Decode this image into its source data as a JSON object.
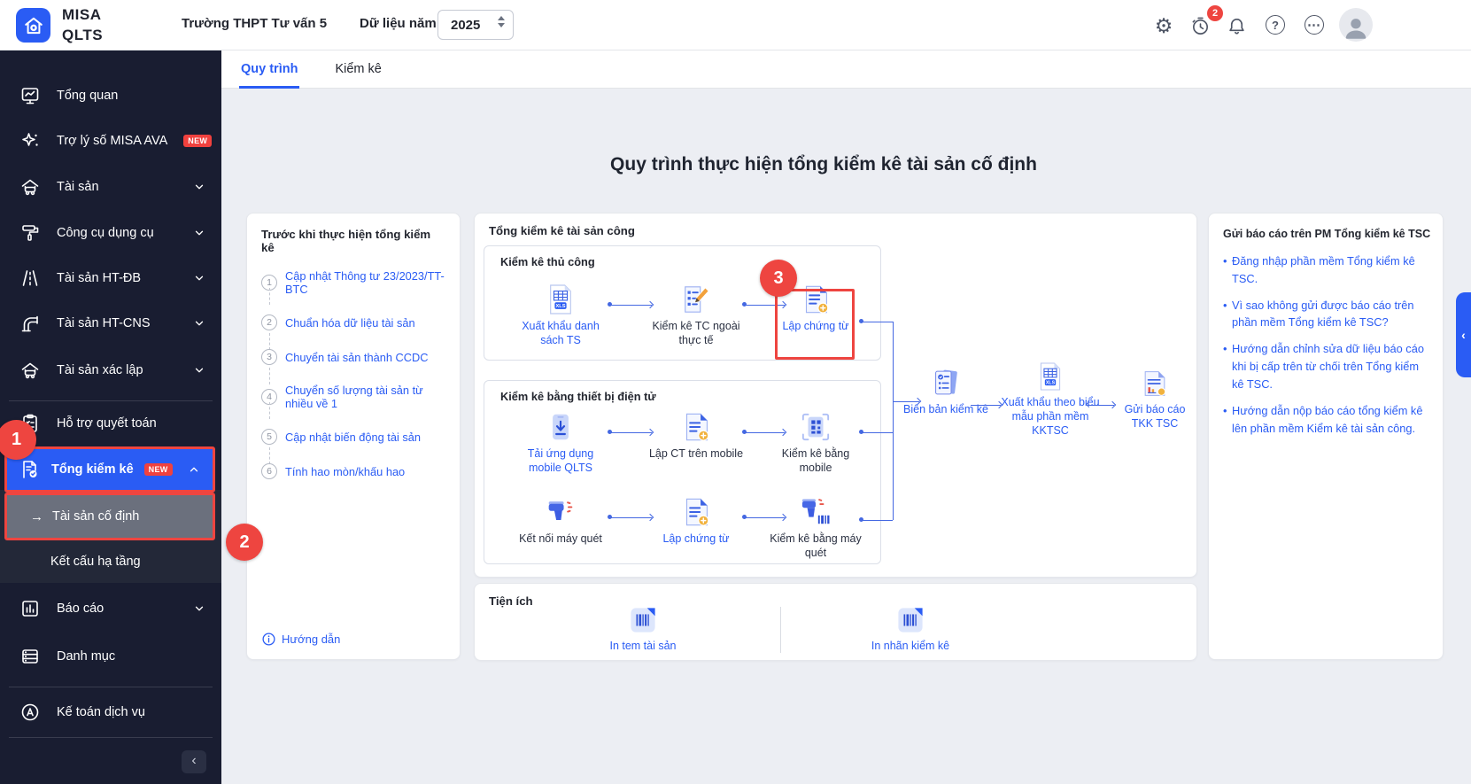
{
  "header": {
    "app_name_top": "MISA",
    "app_name_bottom": "QLTS",
    "org_name": "Trường THPT Tư vấn 5",
    "year_label": "Dữ liệu năm",
    "year_value": "2025",
    "notification_count": "2"
  },
  "sidebar": {
    "items": [
      {
        "label": "Tổng quan"
      },
      {
        "label": "Trợ lý số MISA AVA",
        "badge": "NEW"
      },
      {
        "label": "Tài sản"
      },
      {
        "label": "Công cụ dụng cụ"
      },
      {
        "label": "Tài sản HT-ĐB"
      },
      {
        "label": "Tài sản HT-CNS"
      },
      {
        "label": "Tài sản xác lập"
      },
      {
        "label": "Hỗ trợ quyết toán"
      },
      {
        "label": "Tổng kiểm kê",
        "badge": "NEW"
      },
      {
        "label": "Tài sản cố định"
      },
      {
        "label": "Kết cấu hạ tầng"
      },
      {
        "label": "Báo cáo"
      },
      {
        "label": "Danh mục"
      },
      {
        "label": "Kế toán dịch vụ"
      }
    ]
  },
  "tabs": [
    {
      "label": "Quy trình"
    },
    {
      "label": "Kiểm kê"
    }
  ],
  "page_title": "Quy trình thực hiện tổng kiểm kê tài sản cố định",
  "before_card": {
    "title": "Trước khi thực hiện tổng kiểm kê",
    "steps": [
      {
        "num": "1",
        "label": "Cập nhật Thông tư 23/2023/TT-BTC"
      },
      {
        "num": "2",
        "label": "Chuẩn hóa dữ liệu tài sản"
      },
      {
        "num": "3",
        "label": "Chuyển tài sản thành CCDC"
      },
      {
        "num": "4",
        "label": "Chuyển số lượng tài sản từ nhiều về 1"
      },
      {
        "num": "5",
        "label": "Cập nhật biến động tài sản"
      },
      {
        "num": "6",
        "label": "Tính hao mòn/khấu hao"
      }
    ],
    "guide_label": "Hướng dẫn"
  },
  "flow_card": {
    "title": "Tổng kiểm kê tài sản công",
    "manual_section": {
      "title": "Kiểm kê thủ công",
      "steps": [
        {
          "label": "Xuất khẩu danh sách TS"
        },
        {
          "label": "Kiểm kê TC ngoài thực tế"
        },
        {
          "label": "Lập chứng từ"
        }
      ]
    },
    "electronic_section": {
      "title": "Kiểm kê bằng thiết bị điện tử",
      "row1": [
        {
          "label": "Tải ứng dụng mobile QLTS"
        },
        {
          "label": "Lập CT trên mobile"
        },
        {
          "label": "Kiểm kê bằng mobile"
        }
      ],
      "row2": [
        {
          "label": "Kết nối máy quét"
        },
        {
          "label": "Lập chứng từ"
        },
        {
          "label": "Kiểm kê bằng máy quét"
        }
      ]
    },
    "outputs": [
      {
        "label": "Biên bản kiểm kê"
      },
      {
        "label": "Xuất khẩu theo biểu mẫu phần mềm KKTSC"
      },
      {
        "label": "Gửi báo cáo TKK TSC"
      }
    ]
  },
  "utilities_card": {
    "title": "Tiện ích",
    "items": [
      {
        "label": "In tem tài sản"
      },
      {
        "label": "In nhãn kiểm kê"
      }
    ]
  },
  "help_card": {
    "title": "Gửi báo cáo trên PM Tổng kiểm kê TSC",
    "links": [
      {
        "label": "Đăng nhập phần mềm Tổng kiểm kê TSC."
      },
      {
        "label": "Vì sao không gửi được báo cáo trên phần mềm Tổng kiểm kê TSC?"
      },
      {
        "label": "Hướng dẫn chỉnh sửa dữ liệu báo cáo khi bị cấp trên từ chối trên Tổng kiểm kê TSC."
      },
      {
        "label": "Hướng dẫn nộp báo cáo tổng kiểm kê lên phần mềm Kiểm kê tài sản công."
      }
    ]
  },
  "annotations": {
    "badge1": "1",
    "badge2": "2",
    "badge3": "3"
  },
  "icons": {
    "xls_badge": "XLS"
  },
  "colors": {
    "accent": "#2a5cf4",
    "annotation_red": "#ee4540",
    "sidebar_bg": "#191d31",
    "connector": "#4468e2"
  }
}
